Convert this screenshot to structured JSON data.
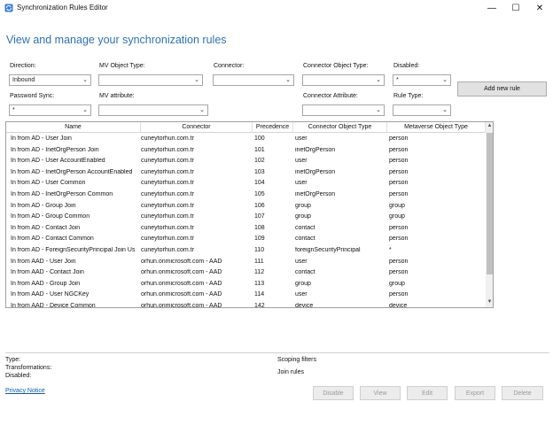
{
  "window": {
    "title": "Synchronization Rules Editor",
    "minimize": "—",
    "maximize": "☐",
    "close": "✕"
  },
  "heading": "View and manage your synchronization rules",
  "filters": {
    "direction": {
      "label": "Direction:",
      "value": "Inbound"
    },
    "mv_object_type": {
      "label": "MV Object Type:",
      "value": ""
    },
    "connector": {
      "label": "Connector:",
      "value": ""
    },
    "connector_object_type": {
      "label": "Connector Object Type:",
      "value": ""
    },
    "disabled": {
      "label": "Disabled:",
      "value": "*"
    },
    "password_sync": {
      "label": "Password Sync:",
      "value": "*"
    },
    "mv_attribute": {
      "label": "MV attribute:",
      "value": ""
    },
    "connector_attribute": {
      "label": "Connector Attribute:",
      "value": ""
    },
    "rule_type": {
      "label": "Rule Type:",
      "value": ""
    }
  },
  "add_new_rule": "Add new rule",
  "table": {
    "columns": [
      "Name",
      "Connector",
      "Precedence",
      "Connector Object Type",
      "Metaverse Object Type"
    ],
    "rows": [
      [
        "In from AD - User Join",
        "cuneytorhun.com.tr",
        "100",
        "user",
        "person"
      ],
      [
        "In from AD - InetOrgPerson Join",
        "cuneytorhun.com.tr",
        "101",
        "inetOrgPerson",
        "person"
      ],
      [
        "In from AD - User AccountEnabled",
        "cuneytorhun.com.tr",
        "102",
        "user",
        "person"
      ],
      [
        "In from AD - InetOrgPerson AccountEnabled",
        "cuneytorhun.com.tr",
        "103",
        "inetOrgPerson",
        "person"
      ],
      [
        "In from AD - User Common",
        "cuneytorhun.com.tr",
        "104",
        "user",
        "person"
      ],
      [
        "In from AD - InetOrgPerson Common",
        "cuneytorhun.com.tr",
        "105",
        "inetOrgPerson",
        "person"
      ],
      [
        "In from AD - Group Join",
        "cuneytorhun.com.tr",
        "106",
        "group",
        "group"
      ],
      [
        "In from AD - Group Common",
        "cuneytorhun.com.tr",
        "107",
        "group",
        "group"
      ],
      [
        "In from AD - Contact Join",
        "cuneytorhun.com.tr",
        "108",
        "contact",
        "person"
      ],
      [
        "In from AD - Contact Common",
        "cuneytorhun.com.tr",
        "109",
        "contact",
        "person"
      ],
      [
        "In from AD - ForeignSecurityPrincipal Join Us",
        "cuneytorhun.com.tr",
        "110",
        "foreignSecurityPrincipal",
        "*"
      ],
      [
        "In from AAD - User Join",
        "orhun.onmicrosoft.com - AAD",
        "111",
        "user",
        "person"
      ],
      [
        "In from AAD - Contact Join",
        "orhun.onmicrosoft.com - AAD",
        "112",
        "contact",
        "person"
      ],
      [
        "In from AAD - Group Join",
        "orhun.onmicrosoft.com - AAD",
        "113",
        "group",
        "group"
      ],
      [
        "In from AAD - User NGCKey",
        "orhun.onmicrosoft.com - AAD",
        "114",
        "user",
        "person"
      ],
      [
        "In from AAD - Device Common",
        "orhun.onmicrosoft.com - AAD",
        "142",
        "device",
        "device"
      ]
    ]
  },
  "details": {
    "type": "Type:",
    "transformations": "Transformations:",
    "disabled": "Disabled:",
    "scoping_filters": "Scoping filters",
    "join_rules": "Join rules"
  },
  "privacy_notice": "Privacy Notice",
  "actions": {
    "disable": "Disable",
    "view": "View",
    "edit": "Edit",
    "export": "Export",
    "delete": "Delete"
  },
  "icons": {
    "app": "sync-rules-app-icon",
    "dropdown": "chevron-down-icon"
  }
}
